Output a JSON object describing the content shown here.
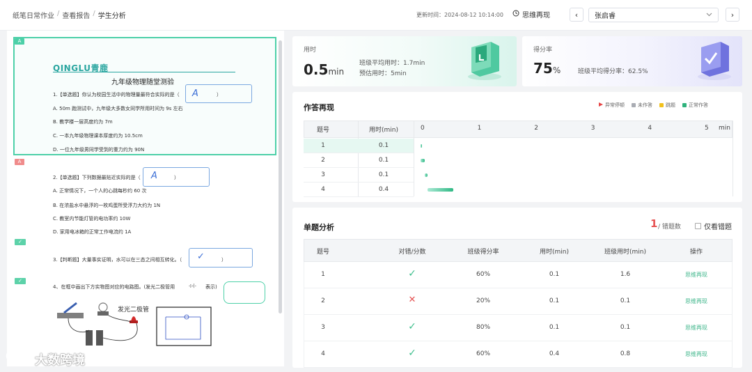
{
  "breadcrumb": [
    "纸笔日常作业",
    "查看报告",
    "学生分析"
  ],
  "header": {
    "updated": "更新时间：2024-08-12 10:14:00",
    "replay_label": "思维再现",
    "student": "张启睿",
    "prev_glyph": "‹",
    "next_glyph": "›"
  },
  "paper": {
    "tag_a": "A",
    "logo_text": "QINGLU青鹿",
    "title": "九年级物理随堂测验",
    "q1": "1.【单选题】你认为校园生活中的物理量最符合实际的是（",
    "q1_close": "）",
    "q1_answer": "A",
    "q1_opts": [
      "A. 50m 跑测试中，九年级大多数女同学所用时间为 9s 左右",
      "B. 教学楼一层高度约为 7m",
      "C. 一本九年级物理课本厚度约为 10.5cm",
      "D. 一位九年级男同学受到的重力约为 90N"
    ],
    "q2": "2.【单选题】下列数据最贴近实际的是（",
    "q2_close": "）",
    "q2_answer": "A",
    "q2_opts": [
      "A. 正常情况下，一个人的心跳每秒约 60 次",
      "B. 在浓盐水中悬浮的一枚鸡蛋所受浮力大约为 1N",
      "C. 教室内节能灯管的电功率约 10W",
      "D. 家用电冰箱的正常工作电流约 1A"
    ],
    "q3": "3.【判断题】大量事实证明，水可以在三态之间相互转化。（",
    "q3_close": "）",
    "q3_answer": "✓",
    "q4": "4、在框中画出下方实物图对应的电路图。(发光二极管用",
    "q4_close": "表示)",
    "q4_symbol": "-▷|-",
    "circuit_label": "发光二极管",
    "check_glyph": "✓"
  },
  "stats": {
    "time_label": "用时",
    "time_value": "0.5",
    "time_unit": "min",
    "class_avg_time": "班级平均用时：1.7min",
    "est_time": "预估用时：5min",
    "score_label": "得分率",
    "score_value": "75",
    "score_unit": "%",
    "class_avg_score": "班级平均得分率：62.5%"
  },
  "replay": {
    "title": "作答再现",
    "legend": [
      {
        "label": "异常停顿",
        "color": "#e64545",
        "icon": "triangle-right-icon"
      },
      {
        "label": "未作答",
        "color": "#a9acb3",
        "icon": "square-icon"
      },
      {
        "label": "跳题",
        "color": "#f2c11c",
        "icon": "square-icon"
      },
      {
        "label": "正常作答",
        "color": "#2fb27c",
        "icon": "square-icon"
      }
    ],
    "col_q": "题号",
    "col_time": "用时(min)",
    "ticks": [
      "0",
      "1",
      "2",
      "3",
      "4",
      "5"
    ],
    "tick_unit": "min",
    "rows": [
      {
        "q": "1",
        "time": "0.1",
        "start": 0.0,
        "end": 0.02
      },
      {
        "q": "2",
        "time": "0.1",
        "start": 0.0,
        "end": 0.07
      },
      {
        "q": "3",
        "time": "0.1",
        "start": 0.07,
        "end": 0.12
      },
      {
        "q": "4",
        "time": "0.4",
        "start": 0.12,
        "end": 0.58
      }
    ]
  },
  "analysis": {
    "title": "单题分析",
    "wrong_count": "1",
    "wrong_label": "/ 错题数",
    "only_wrong": "仅看错题",
    "headers": [
      "题号",
      "对错/分数",
      "班级得分率",
      "用时(min)",
      "班级用时(min)",
      "操作"
    ],
    "rows": [
      {
        "q": "1",
        "correct": true,
        "rate": "60%",
        "time": "0.1",
        "class_time": "1.6",
        "action": "思维再现"
      },
      {
        "q": "2",
        "correct": false,
        "rate": "20%",
        "time": "0.1",
        "class_time": "0.1",
        "action": "思维再现"
      },
      {
        "q": "3",
        "correct": true,
        "rate": "80%",
        "time": "0.1",
        "class_time": "0.1",
        "action": "思维再现"
      },
      {
        "q": "4",
        "correct": true,
        "rate": "60%",
        "time": "0.4",
        "class_time": "0.8",
        "action": "思维再现"
      }
    ],
    "ok_glyph": "✓",
    "x_glyph": "✕"
  },
  "watermark": "大数跨境"
}
